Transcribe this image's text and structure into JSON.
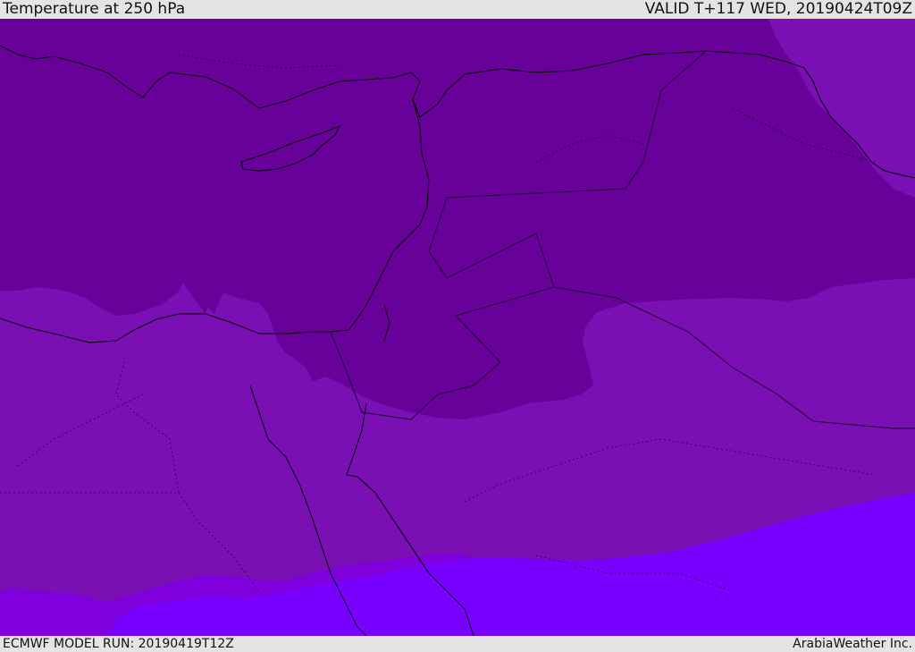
{
  "header": {
    "title": "Temperature at 250 hPa",
    "valid": "VALID T+117 WED, 20190424T09Z"
  },
  "footer": {
    "model_run": "ECMWF MODEL RUN: 20190419T12Z",
    "credit": "ArabiaWeather Inc."
  },
  "colors": {
    "band_coldest": "#68009a",
    "band_cold": "#7a10b4",
    "band_mild": "#7f00dc",
    "band_warm": "#7800ff",
    "coast": "#000000",
    "border": "#1a0030"
  }
}
